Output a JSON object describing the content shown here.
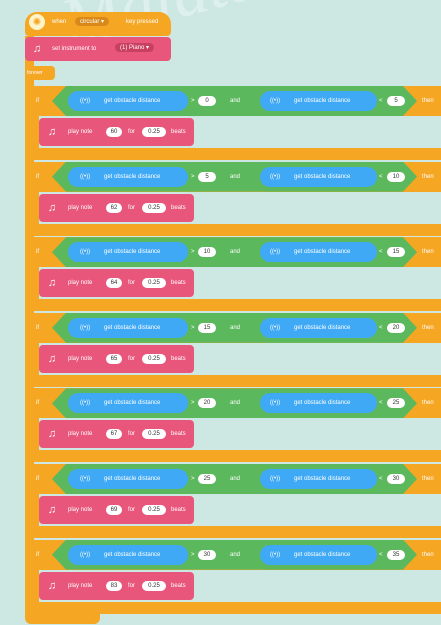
{
  "watermark": "Mafata",
  "hat": {
    "when_label": "when",
    "dropdown_value": "circular",
    "event_label": "key pressed"
  },
  "set_instrument": {
    "label": "set instrument to",
    "dropdown_value": "(1) Piano"
  },
  "forever_label": "forever",
  "if_label": "if",
  "and_label": "and",
  "then_label": "then",
  "sensor_label": "get obstacle distance",
  "play_label": "play note",
  "for_label": "for",
  "beats_label": "beats",
  "rows": [
    {
      "op1": ">",
      "v1": "0",
      "op2": "<",
      "v2": "5",
      "note": "60",
      "beats": "0.25"
    },
    {
      "op1": ">",
      "v1": "5",
      "op2": "<",
      "v2": "10",
      "note": "62",
      "beats": "0.25"
    },
    {
      "op1": ">",
      "v1": "10",
      "op2": "<",
      "v2": "15",
      "note": "64",
      "beats": "0.25"
    },
    {
      "op1": ">",
      "v1": "15",
      "op2": "<",
      "v2": "20",
      "note": "65",
      "beats": "0.25"
    },
    {
      "op1": ">",
      "v1": "20",
      "op2": "<",
      "v2": "25",
      "note": "67",
      "beats": "0.25"
    },
    {
      "op1": ">",
      "v1": "25",
      "op2": "<",
      "v2": "30",
      "note": "69",
      "beats": "0.25"
    },
    {
      "op1": ">",
      "v1": "30",
      "op2": "<",
      "v2": "35",
      "note": "83",
      "beats": "0.25"
    }
  ],
  "colors": {
    "control": "#f5a623",
    "sensor": "#3fa9f5",
    "operator": "#5cb85c",
    "music": "#e8567b"
  },
  "icons": {
    "hat": "gear-icon",
    "sensor": "sensor-icon",
    "music": "music-note-icon"
  }
}
